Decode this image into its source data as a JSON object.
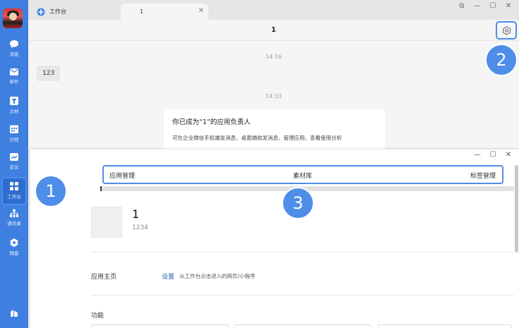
{
  "sidebar": {
    "items": [
      {
        "label": "消息",
        "icon": "chat-bubble-icon"
      },
      {
        "label": "邮件",
        "icon": "mail-icon"
      },
      {
        "label": "文档",
        "icon": "document-icon"
      },
      {
        "label": "日程",
        "icon": "calendar-icon"
      },
      {
        "label": "会议",
        "icon": "meeting-icon"
      },
      {
        "label": "工作台",
        "icon": "grid-icon"
      },
      {
        "label": "通讯录",
        "icon": "contacts-icon"
      },
      {
        "label": "微盘",
        "icon": "drive-icon"
      }
    ]
  },
  "tabs": {
    "workbench": "工作台",
    "chat": "1",
    "close": "✕"
  },
  "window_controls": {
    "popout": "⧉",
    "minimize": "—",
    "maximize": "☐",
    "close": "✕"
  },
  "chat": {
    "title": "1",
    "timestamp_1": "14:16",
    "message_1": "123",
    "timestamp_2": "14:33",
    "card_title": "你已成为“1”的应用负责人",
    "card_desc": "可在企业微信手机端发消息、桌面端收发消息、管理应用、查看使用分析"
  },
  "callouts": {
    "one": "1",
    "two": "2",
    "three": "3"
  },
  "app_window": {
    "controls": {
      "minimize": "—",
      "maximize": "☐",
      "close": "✕"
    },
    "tabs": [
      "应用管理",
      "素材库",
      "标签管理"
    ],
    "app_name": "1",
    "app_id": "1234",
    "homepage_label": "应用主页",
    "homepage_link": "设置",
    "homepage_hint": "从工作台点击进入的网页/小程序",
    "features_label": "功能"
  },
  "colors": {
    "accent": "#4e8de8",
    "sidebar": "#3f7fe0"
  }
}
